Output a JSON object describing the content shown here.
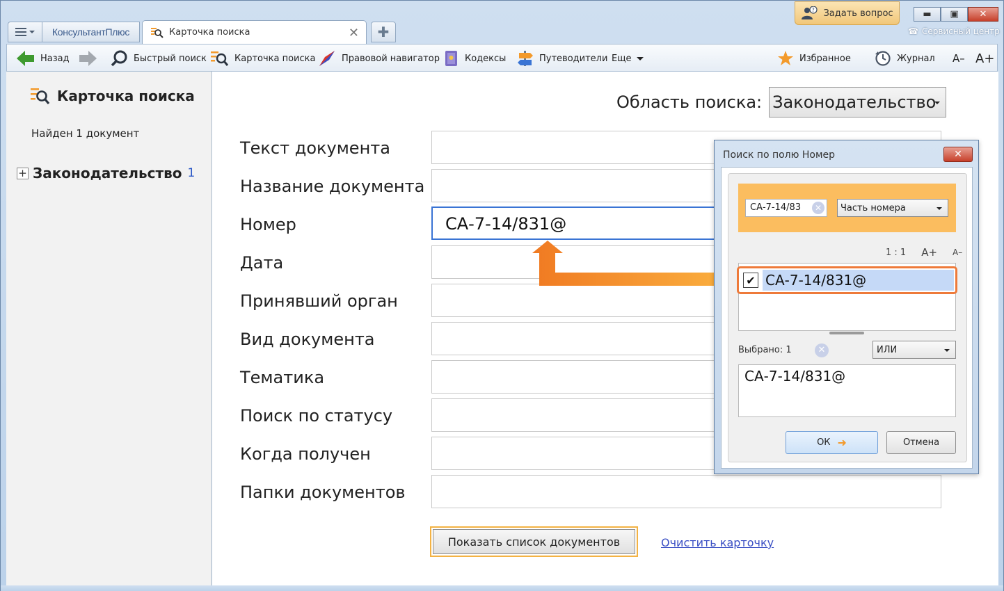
{
  "menu": {
    "brand": "КонсультантПлюс"
  },
  "tabs": [
    {
      "label": "Карточка поиска"
    }
  ],
  "header": {
    "ask_label": "Задать вопрос",
    "service_label": "Сервисный центр"
  },
  "toolbar": {
    "back": "Назад",
    "quick_search": "Быстрый поиск",
    "search_card": "Карточка поиска",
    "legal_nav": "Правовой навигатор",
    "codes": "Кодексы",
    "guides": "Путеводители",
    "more": "Еще",
    "favorites": "Избранное",
    "journal": "Журнал",
    "font_minus": "А–",
    "font_plus": "А+"
  },
  "sidebar": {
    "title": "Карточка поиска",
    "found": "Найден 1 документ",
    "tree_item": "Законодательство",
    "tree_count": "1"
  },
  "form": {
    "area_label": "Область поиска:",
    "area_value": "Законодательство",
    "fields": [
      {
        "label": "Текст документа",
        "value": ""
      },
      {
        "label": "Название документа",
        "value": ""
      },
      {
        "label": "Номер",
        "value": "СА-7-14/831@"
      },
      {
        "label": "Дата",
        "value": ""
      },
      {
        "label": "Принявший орган",
        "value": ""
      },
      {
        "label": "Вид документа",
        "value": ""
      },
      {
        "label": "Тематика",
        "value": ""
      },
      {
        "label": "Поиск по статусу",
        "value": ""
      },
      {
        "label": "Когда получен",
        "value": ""
      },
      {
        "label": "Папки документов",
        "value": ""
      }
    ],
    "show_button": "Показать список документов",
    "clear_link": "Очистить карточку"
  },
  "dialog": {
    "title": "Поиск по полю Номер",
    "input_value": "СА-7-14/83",
    "match_mode": "Часть номера",
    "zoom_ratio": "1 : 1",
    "zoom_plus": "А+",
    "zoom_minus": "А–",
    "list_items": [
      {
        "text": "СА-7-14/831@",
        "checked": true
      }
    ],
    "selected_label": "Выбрано: 1",
    "logic": "ИЛИ",
    "selected_value": "СА-7-14/831@",
    "ok": "ОК",
    "cancel": "Отмена"
  },
  "colors": {
    "accent_orange": "#f39a2b",
    "highlight_blue": "#c5d9f7",
    "link": "#3a4fc4"
  }
}
